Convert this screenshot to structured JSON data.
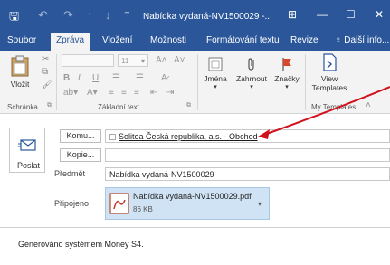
{
  "window": {
    "title": "Nabídka vydaná-NV1500029 -...",
    "icons": [
      "save-icon",
      "undo-icon",
      "redo-icon",
      "up-icon",
      "down-icon",
      "more-icon"
    ],
    "controls": [
      "ribbon-display-icon",
      "minimize-icon",
      "maximize-icon",
      "close-icon"
    ]
  },
  "tabs": [
    {
      "label": "Soubor",
      "active": false
    },
    {
      "label": "Zpráva",
      "active": true
    },
    {
      "label": "Vložení",
      "active": false
    },
    {
      "label": "Možnosti",
      "active": false
    },
    {
      "label": "Formátování textu",
      "active": false
    },
    {
      "label": "Revize",
      "active": false
    },
    {
      "label": "Další info...",
      "active": false
    }
  ],
  "ribbon": {
    "paste_label": "Vložit",
    "clipboard_group": "Schránka",
    "font_size": "11",
    "basic_text_group": "Základní text",
    "names_label": "Jména",
    "include_label": "Zahrnout",
    "tags_label": "Značky",
    "view_templates_label_1": "View",
    "view_templates_label_2": "Templates",
    "my_templates_group": "My Templates",
    "bold": "B",
    "italic": "I",
    "underline": "U"
  },
  "compose": {
    "send_label": "Poslat",
    "to_button": "Komu...",
    "cc_button": "Kopie...",
    "subject_label": "Předmět",
    "attached_label": "Připojeno",
    "to_value": "Solitea Česká republika, a.s. - Obchod",
    "cc_value": "",
    "subject_value": "Nabídka vydaná-NV1500029",
    "attachment_name": "Nabídka vydaná-NV1500029.pdf",
    "attachment_size": "86 KB",
    "body": "Generováno systémem Money S4."
  },
  "colors": {
    "title_bar": "#2b579a",
    "ribbon": "#f3f3f3",
    "attachment_bg": "#cfe3f5",
    "annotation_arrow": "#d0101b"
  }
}
